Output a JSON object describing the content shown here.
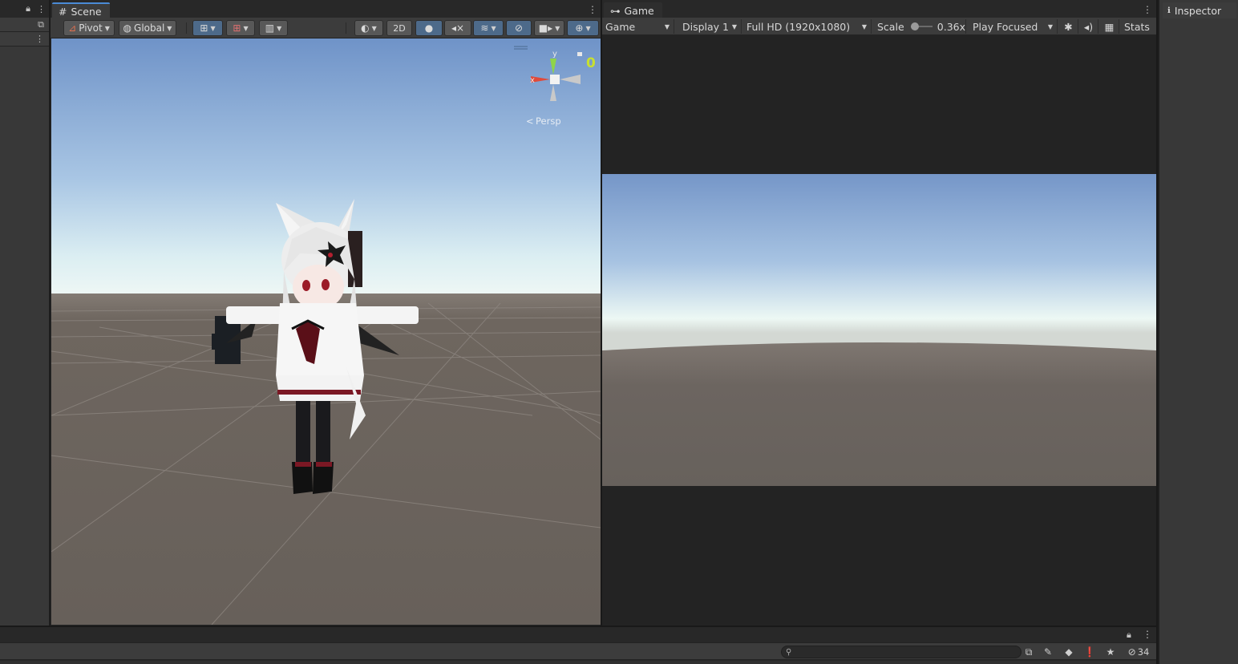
{
  "scene": {
    "tab_label": "Scene",
    "pivot_label": "Pivot",
    "global_label": "Global",
    "btn_2d": "2D",
    "gizmo": {
      "y": "y",
      "x": "x",
      "counter": "0",
      "persp": "Persp"
    }
  },
  "game": {
    "tab_label": "Game",
    "view_select": "Game",
    "display_select": "Display 1",
    "resolution_select": "Full HD (1920x1080)",
    "scale_label": "Scale",
    "scale_value": "0.36x",
    "scale_fraction": 0.36,
    "play_mode_select": "Play Focused",
    "stats_label": "Stats"
  },
  "inspector": {
    "tab_label": "Inspector"
  },
  "console": {
    "hidden_count": "34"
  },
  "colors": {
    "accent": "#4b8bd6",
    "panel": "#383838",
    "toolbar": "#3c3c3c",
    "active_button": "#4d6a8a",
    "sky_top": "#6f93c8",
    "horizon": "#eef6f6",
    "ground": "#6a625c"
  },
  "icons": {
    "lock": "lock-icon",
    "kebab": "kebab-menu-icon",
    "grid": "grid-icon",
    "gamepad": "gamepad-icon",
    "info": "info-icon"
  }
}
